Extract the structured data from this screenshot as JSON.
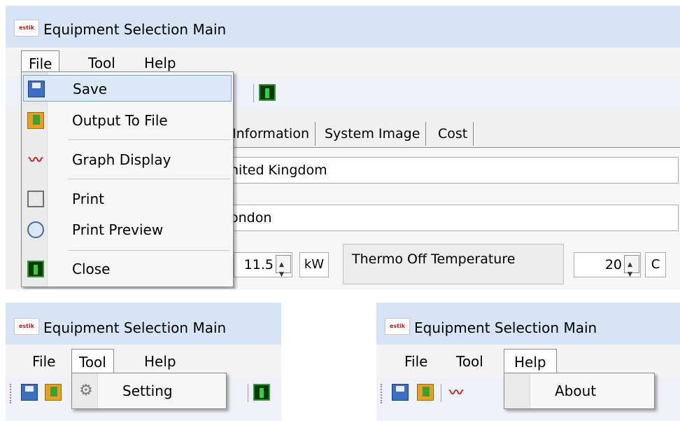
{
  "window_title": "Equipment Selection Main",
  "menus": {
    "file": "File",
    "tool": "Tool",
    "help": "Help"
  },
  "file_menu": [
    {
      "label": "Save",
      "icon": "save-icon"
    },
    {
      "label": "Output To File",
      "icon": "export-icon"
    },
    {
      "label": "Graph Display",
      "icon": "graph-icon"
    },
    {
      "label": "Print",
      "icon": "print-icon"
    },
    {
      "label": "Print Preview",
      "icon": "print-preview-icon"
    },
    {
      "label": "Close",
      "icon": "close-icon"
    }
  ],
  "tool_menu": [
    {
      "label": "Setting",
      "icon": "gear-icon"
    }
  ],
  "help_menu": [
    {
      "label": "About"
    }
  ],
  "tabs": [
    "Information",
    "System Image",
    "Cost"
  ],
  "fields": {
    "country": "nited Kingdom",
    "city": "ondon"
  },
  "capacity": {
    "value": "11.5",
    "unit": "kW"
  },
  "thermo": {
    "label": "Thermo Off Temperature",
    "value": "20",
    "unit": "C"
  },
  "colors": {
    "highlight": "#dbe9fb",
    "titlebar": "#d6e4f5"
  }
}
